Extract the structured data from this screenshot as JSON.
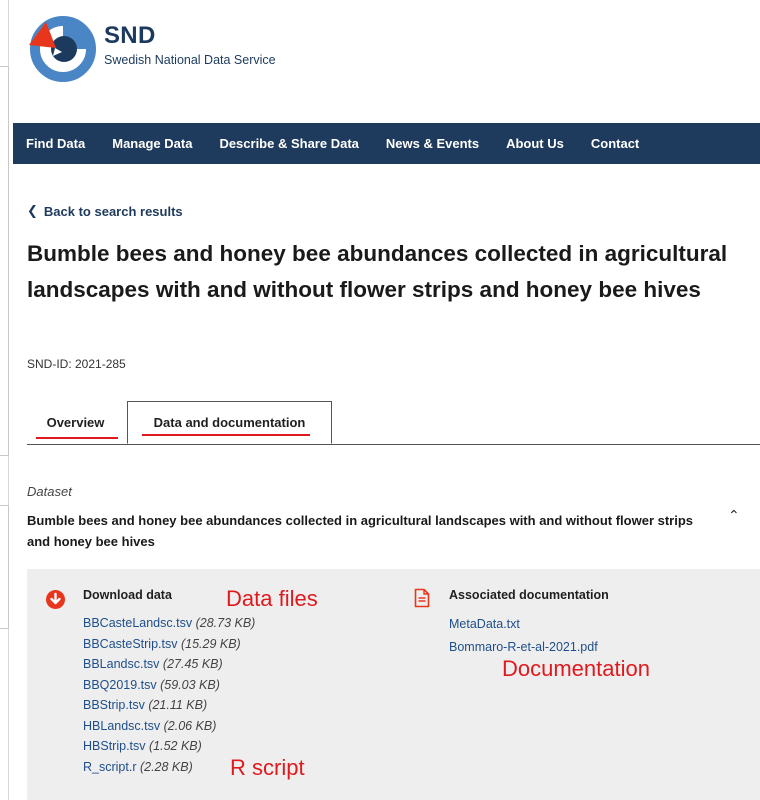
{
  "brand": {
    "name": "SND",
    "subtitle": "Swedish National Data Service"
  },
  "nav": {
    "items": [
      "Find Data",
      "Manage Data",
      "Describe & Share Data",
      "News & Events",
      "About Us",
      "Contact"
    ]
  },
  "back_link": "Back to search results",
  "page_title": "Bumble bees and honey bee abundances collected in agricultural landscapes with and without flower strips and honey bee hives",
  "snd_id": "SND-ID: 2021-285",
  "tabs": [
    {
      "label": "Overview",
      "active": false
    },
    {
      "label": "Data and documentation",
      "active": true
    }
  ],
  "dataset": {
    "label": "Dataset",
    "title": "Bumble bees and honey bee abundances collected in agricultural landscapes with and without flower strips and honey bee hives"
  },
  "download": {
    "heading": "Download data",
    "files": [
      {
        "name": "BBCasteLandsc.tsv",
        "size": "(28.73 KB)"
      },
      {
        "name": "BBCasteStrip.tsv",
        "size": "(15.29 KB)"
      },
      {
        "name": "BBLandsc.tsv",
        "size": "(27.45 KB)"
      },
      {
        "name": "BBQ2019.tsv",
        "size": "(59.03 KB)"
      },
      {
        "name": "BBStrip.tsv",
        "size": "(21.11 KB)"
      },
      {
        "name": "HBLandsc.tsv",
        "size": "(2.06 KB)"
      },
      {
        "name": "HBStrip.tsv",
        "size": "(1.52 KB)"
      },
      {
        "name": "R_script.r",
        "size": "(2.28 KB)"
      }
    ]
  },
  "documentation": {
    "heading": "Associated documentation",
    "files": [
      "MetaData.txt",
      "Bommaro-R-et-al-2021.pdf"
    ]
  },
  "annotations": {
    "data_files": "Data files",
    "documentation": "Documentation",
    "r_script": "R script"
  },
  "colors": {
    "nav_bg": "#1e3a5c",
    "accent_red": "#e0191e",
    "link": "#1f4f8a",
    "panel_bg": "#eeeeee"
  },
  "icons": [
    "snd-logo",
    "chevron-left-icon",
    "chevron-up-icon",
    "download-icon",
    "document-icon"
  ]
}
